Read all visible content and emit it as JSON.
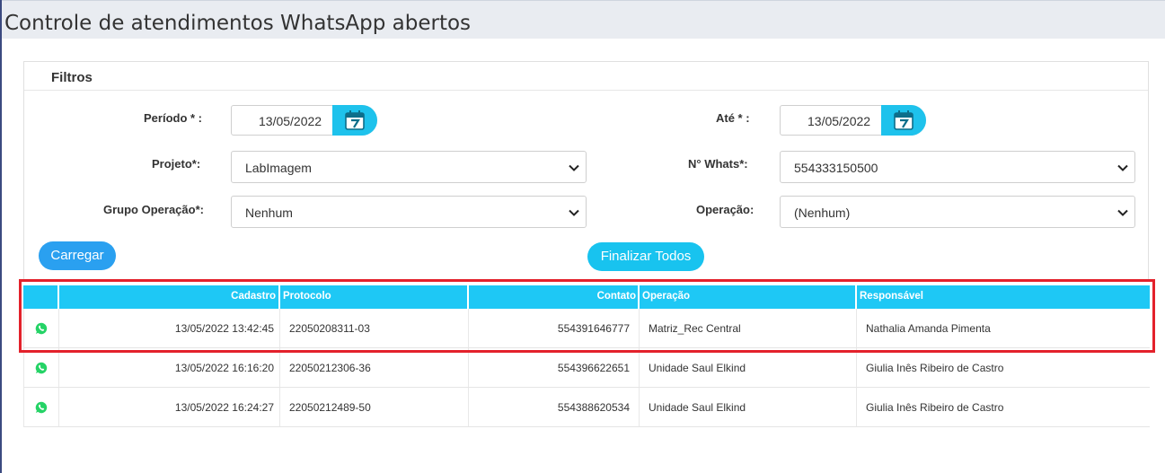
{
  "page": {
    "title": "Controle de atendimentos WhatsApp abertos"
  },
  "filters": {
    "title": "Filtros",
    "periodo_label": "Período * :",
    "periodo_value": "13/05/2022",
    "ate_label": "Até * :",
    "ate_value": "13/05/2022",
    "projeto_label": "Projeto*:",
    "projeto_value": "LabImagem",
    "whats_label": "N° Whats*:",
    "whats_value": "554333150500",
    "grupo_label": "Grupo Operação*:",
    "grupo_value": "Nenhum",
    "operacao_label": "Operação:",
    "operacao_value": "(Nenhum)"
  },
  "buttons": {
    "load": "Carregar",
    "finish_all": "Finalizar Todos"
  },
  "table": {
    "headers": [
      "",
      "Cadastro",
      "Protocolo",
      "Contato",
      "Operação",
      "Responsável"
    ],
    "rows": [
      {
        "cadastro": "13/05/2022 13:42:45",
        "protocolo": "22050208311-03",
        "contato": "554391646777",
        "operacao": "Matriz_Rec Central",
        "responsavel": "Nathalia Amanda Pimenta"
      },
      {
        "cadastro": "13/05/2022 16:16:20",
        "protocolo": "22050212306-36",
        "contato": "554396622651",
        "operacao": "Unidade Saul Elkind",
        "responsavel": "Giulia Inês Ribeiro de Castro"
      },
      {
        "cadastro": "13/05/2022 16:24:27",
        "protocolo": "22050212489-50",
        "contato": "554388620534",
        "operacao": "Unidade Saul Elkind",
        "responsavel": "Giulia Inês Ribeiro de Castro"
      }
    ]
  },
  "colors": {
    "accent": "#1ec8f5",
    "button": "#2aa0f0",
    "highlight": "#e3212b",
    "whatsapp": "#25d366"
  },
  "icons": {
    "calendar": "calendar-icon",
    "dropdown": "chevron-down-icon",
    "row_icon": "whatsapp-icon"
  }
}
